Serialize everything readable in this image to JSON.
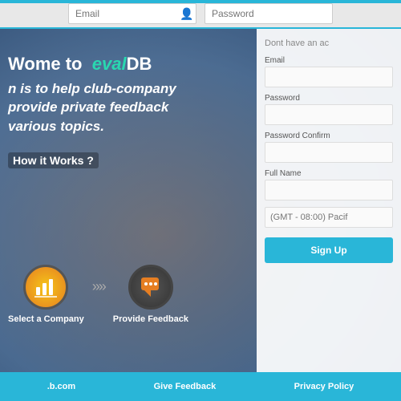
{
  "topbar": {
    "email_placeholder": "Email",
    "password_placeholder": "Password"
  },
  "hero": {
    "welcome_prefix": "ome to",
    "brand_eval": "eval",
    "brand_db": "DB",
    "tagline_line1": "n is to help club-company",
    "tagline_line2": "provide private feedback",
    "tagline_line3": "various topics.",
    "how_it_works": "How it Works ?"
  },
  "steps": [
    {
      "label": "Select a Company",
      "icon": "chart"
    },
    {
      "label": "Provide Feedback",
      "icon": "chat"
    }
  ],
  "signup": {
    "heading": "Dont have an ac",
    "email_label": "Email",
    "password_label": "Password",
    "password_confirm_label": "Password Confirm",
    "fullname_label": "Full Name",
    "timezone_placeholder": "(GMT - 08:00) Pacif",
    "button_label": "Sign Up"
  },
  "footer": {
    "site": ".b.com",
    "give_feedback": "Give Feedback",
    "privacy_policy": "Privacy Policy"
  }
}
